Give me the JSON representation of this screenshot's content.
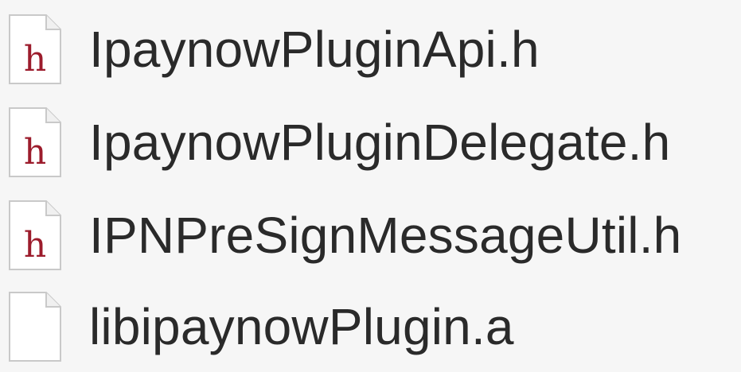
{
  "files": [
    {
      "name": "IpaynowPluginApi.h",
      "icon": "header-file-icon",
      "icon_glyph": "h"
    },
    {
      "name": "IpaynowPluginDelegate.h",
      "icon": "header-file-icon",
      "icon_glyph": "h"
    },
    {
      "name": "IPNPreSignMessageUtil.h",
      "icon": "header-file-icon",
      "icon_glyph": "h"
    },
    {
      "name": "libipaynowPlugin.a",
      "icon": "blank-document-icon",
      "icon_glyph": ""
    }
  ],
  "colors": {
    "background": "#f6f6f6",
    "text": "#2a2a2a",
    "header_glyph": "#9c1c2c"
  }
}
